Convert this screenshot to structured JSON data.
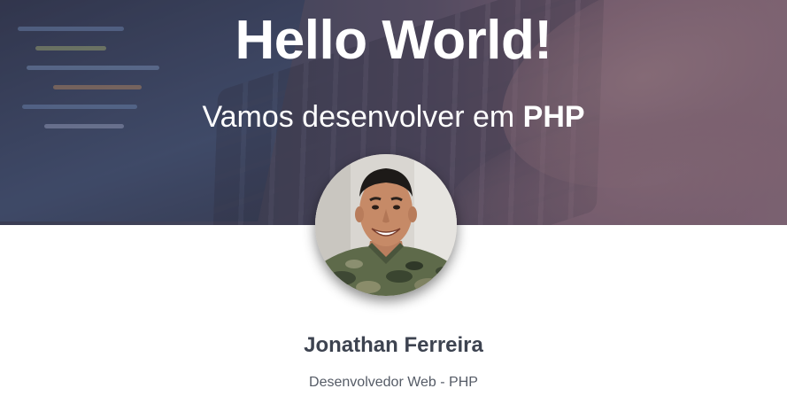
{
  "hero": {
    "title": "Hello World!",
    "subtitle_prefix": "Vamos desenvolver em ",
    "subtitle_strong": "PHP"
  },
  "profile": {
    "name": "Jonathan Ferreira",
    "role": "Desenvolvedor Web - PHP"
  },
  "colors": {
    "hero_overlay": "#3b4358",
    "title_text": "#ffffff",
    "name_text": "#3d4350",
    "role_text": "#555b66",
    "background": "#ffffff"
  }
}
